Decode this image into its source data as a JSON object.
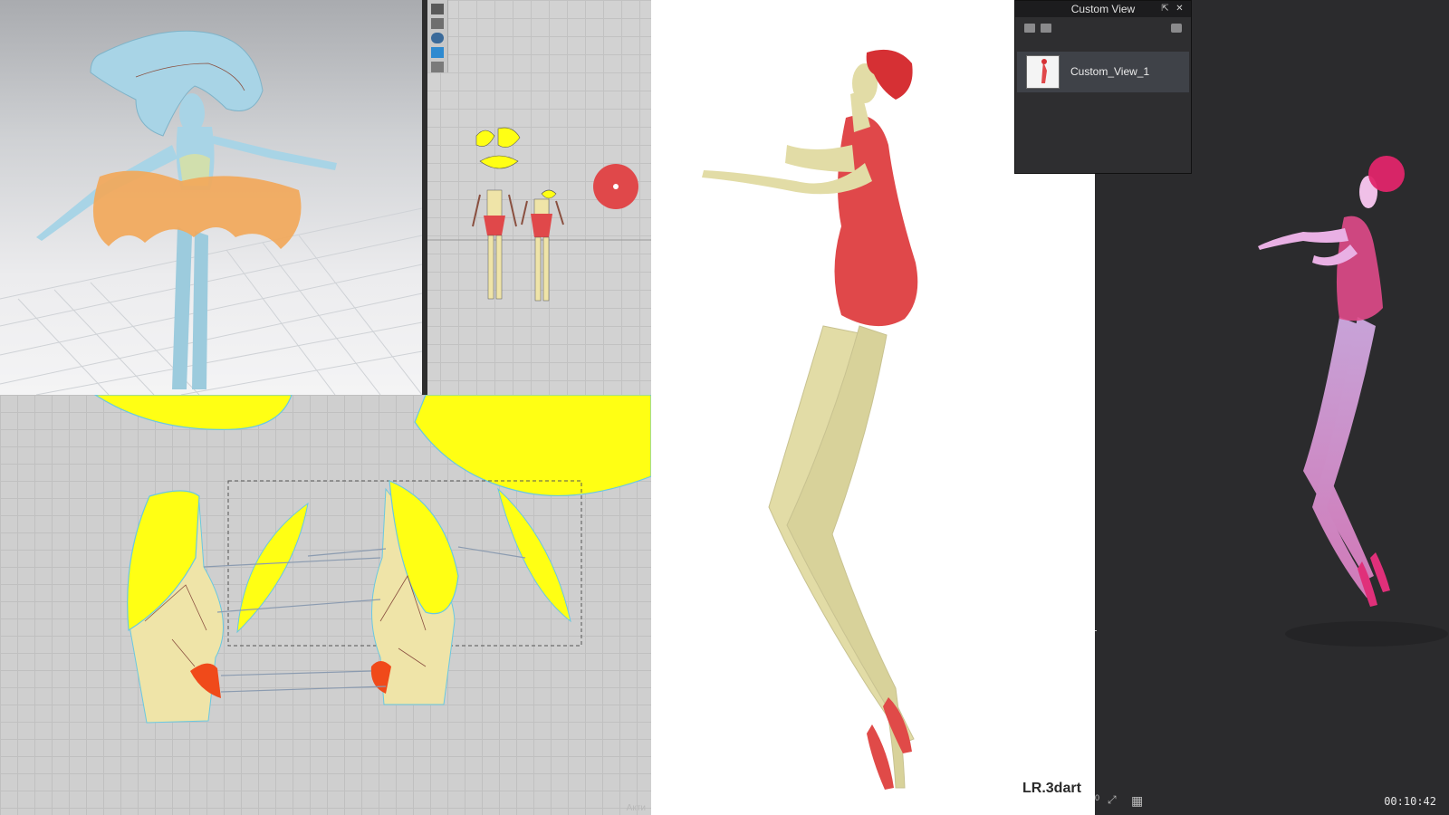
{
  "custom_view_panel": {
    "title": "Custom View",
    "pin_icon": "pin-icon",
    "close_icon": "close-icon",
    "open_icon": "folder-open-icon",
    "save_icon": "save-icon",
    "camera_icon": "camera-icon",
    "items": [
      {
        "label": "Custom_View_1"
      }
    ]
  },
  "render_view": {
    "watermark": "LR.3dart"
  },
  "dark_viewport": {
    "timer": "00:10:42",
    "zoom_100_label": "100",
    "zoom_fit_icon": "zoom-fit-icon",
    "grid_icon": "grid-icon",
    "axis_icon": "axis-corner-icon"
  },
  "colors": {
    "pattern_yellow": "#ffff14",
    "pattern_skin": "#efe4a8",
    "garment_red": "#e0484a",
    "skirt_orange": "#f2a85a",
    "avatar_blue": "#a8d4e6",
    "panel_dark": "#2b2b2d"
  }
}
